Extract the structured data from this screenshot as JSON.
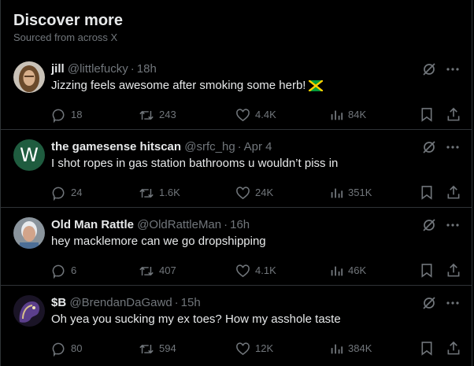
{
  "header": {
    "title": "Discover more",
    "subtitle": "Sourced from across X"
  },
  "tweets": [
    {
      "name": "jill",
      "handle": "@littlefucky",
      "time": "18h",
      "text": "Jizzing feels awesome after smoking some herb!",
      "emoji": "jamaica-flag",
      "replies": "18",
      "reposts": "243",
      "likes": "4.4K",
      "views": "84K"
    },
    {
      "name": "the gamesense hitscan",
      "handle": "@srfc_hg",
      "time": "Apr 4",
      "text": "I shot ropes in gas station bathrooms u wouldn’t piss in",
      "avatar_letter": "W",
      "replies": "24",
      "reposts": "1.6K",
      "likes": "24K",
      "views": "351K"
    },
    {
      "name": "Old Man Rattle",
      "handle": "@OldRattleMan",
      "time": "16h",
      "text": "hey macklemore can we go dropshipping",
      "replies": "6",
      "reposts": "407",
      "likes": "4.1K",
      "views": "46K"
    },
    {
      "name": "$B",
      "handle": "@BrendanDaGawd",
      "time": "15h",
      "text": "Oh yea you sucking my ex toes? How my asshole taste",
      "replies": "80",
      "reposts": "594",
      "likes": "12K",
      "views": "384K"
    }
  ],
  "colors": {
    "background": "#000000",
    "text": "#e7e9ea",
    "muted": "#71767b",
    "divider": "#2f3336",
    "avatar_green": "#1f5c3f"
  },
  "separator": "·"
}
